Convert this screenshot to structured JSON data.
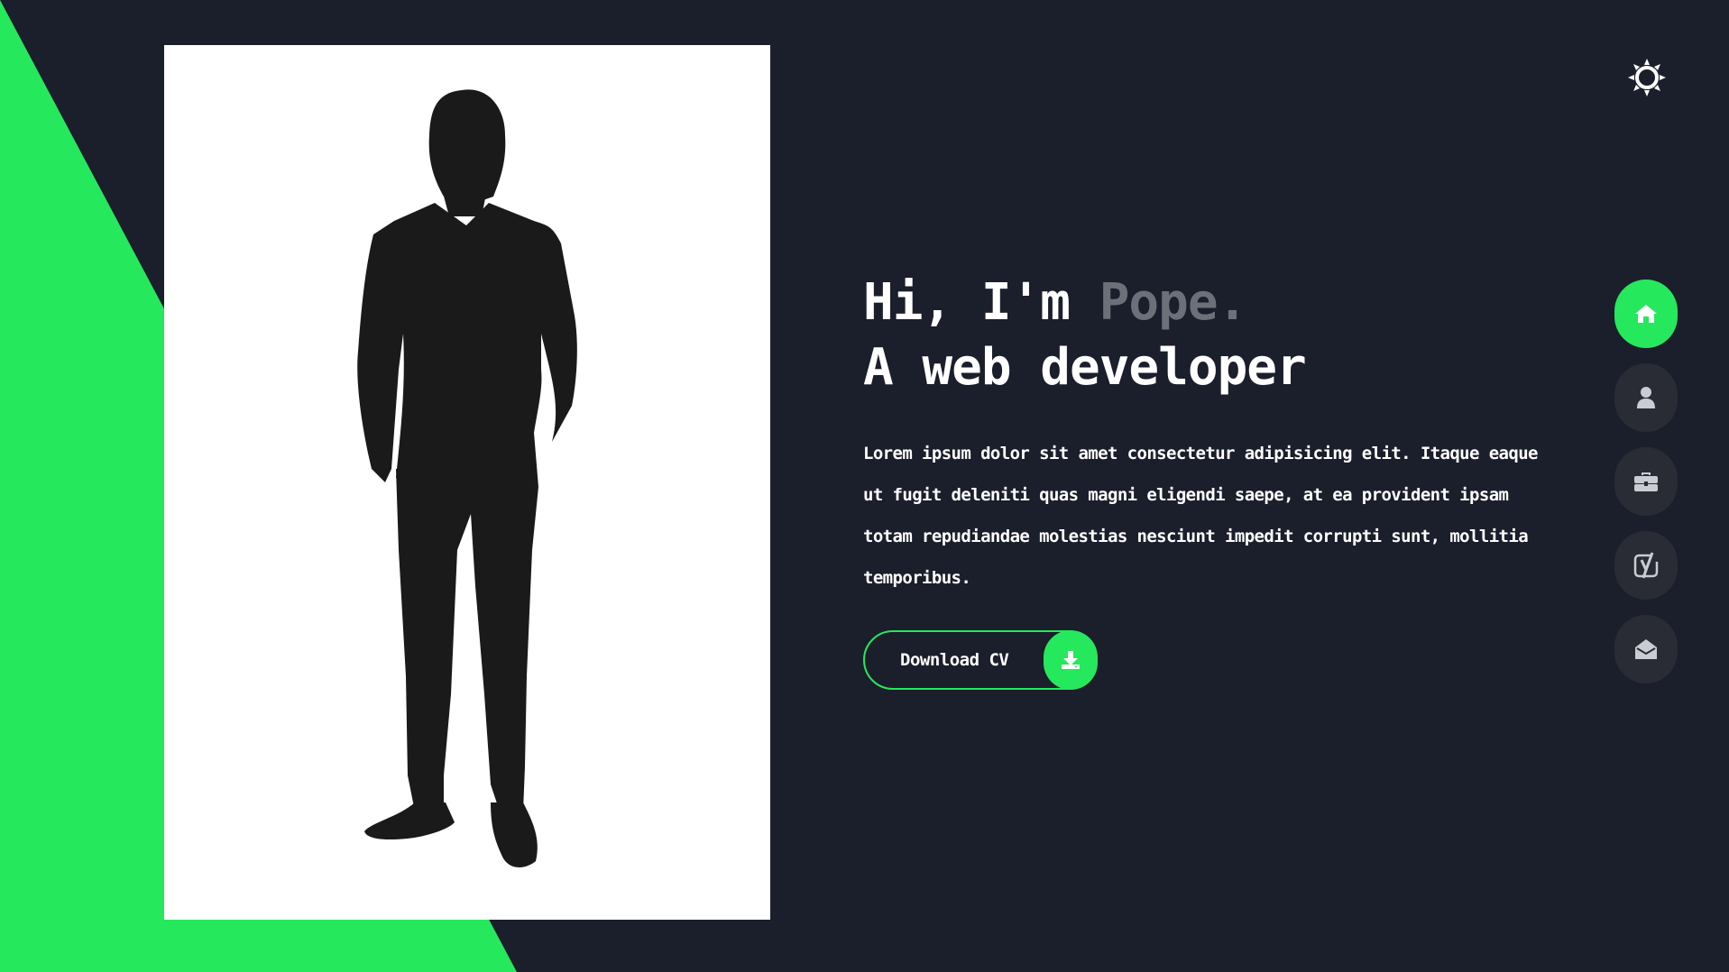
{
  "colors": {
    "background": "#1b1e2b",
    "accent": "#26e85d",
    "muted_name": "#6b7079",
    "nav_button_bg": "#2a2c35",
    "text": "#ffffff"
  },
  "hero": {
    "greeting": "Hi, I'm ",
    "name": "Pope.",
    "role": "A web developer",
    "description": "Lorem ipsum dolor sit amet consectetur adipisicing elit. Itaque eaque ut fugit deleniti quas magni eligendi saepe, at ea provident ipsam totam repudiandae molestias nesciunt impedit corrupti sunt, mollitia temporibus."
  },
  "cv_button": {
    "label": "Download CV",
    "icon": "download-icon"
  },
  "theme_toggle": {
    "icon": "sun-icon"
  },
  "side_nav": {
    "items": [
      {
        "icon": "home-icon",
        "active": true
      },
      {
        "icon": "user-icon",
        "active": false
      },
      {
        "icon": "briefcase-icon",
        "active": false
      },
      {
        "icon": "yoast-icon",
        "active": false
      },
      {
        "icon": "envelope-open-icon",
        "active": false
      }
    ]
  },
  "portrait": {
    "icon": "person-silhouette"
  }
}
